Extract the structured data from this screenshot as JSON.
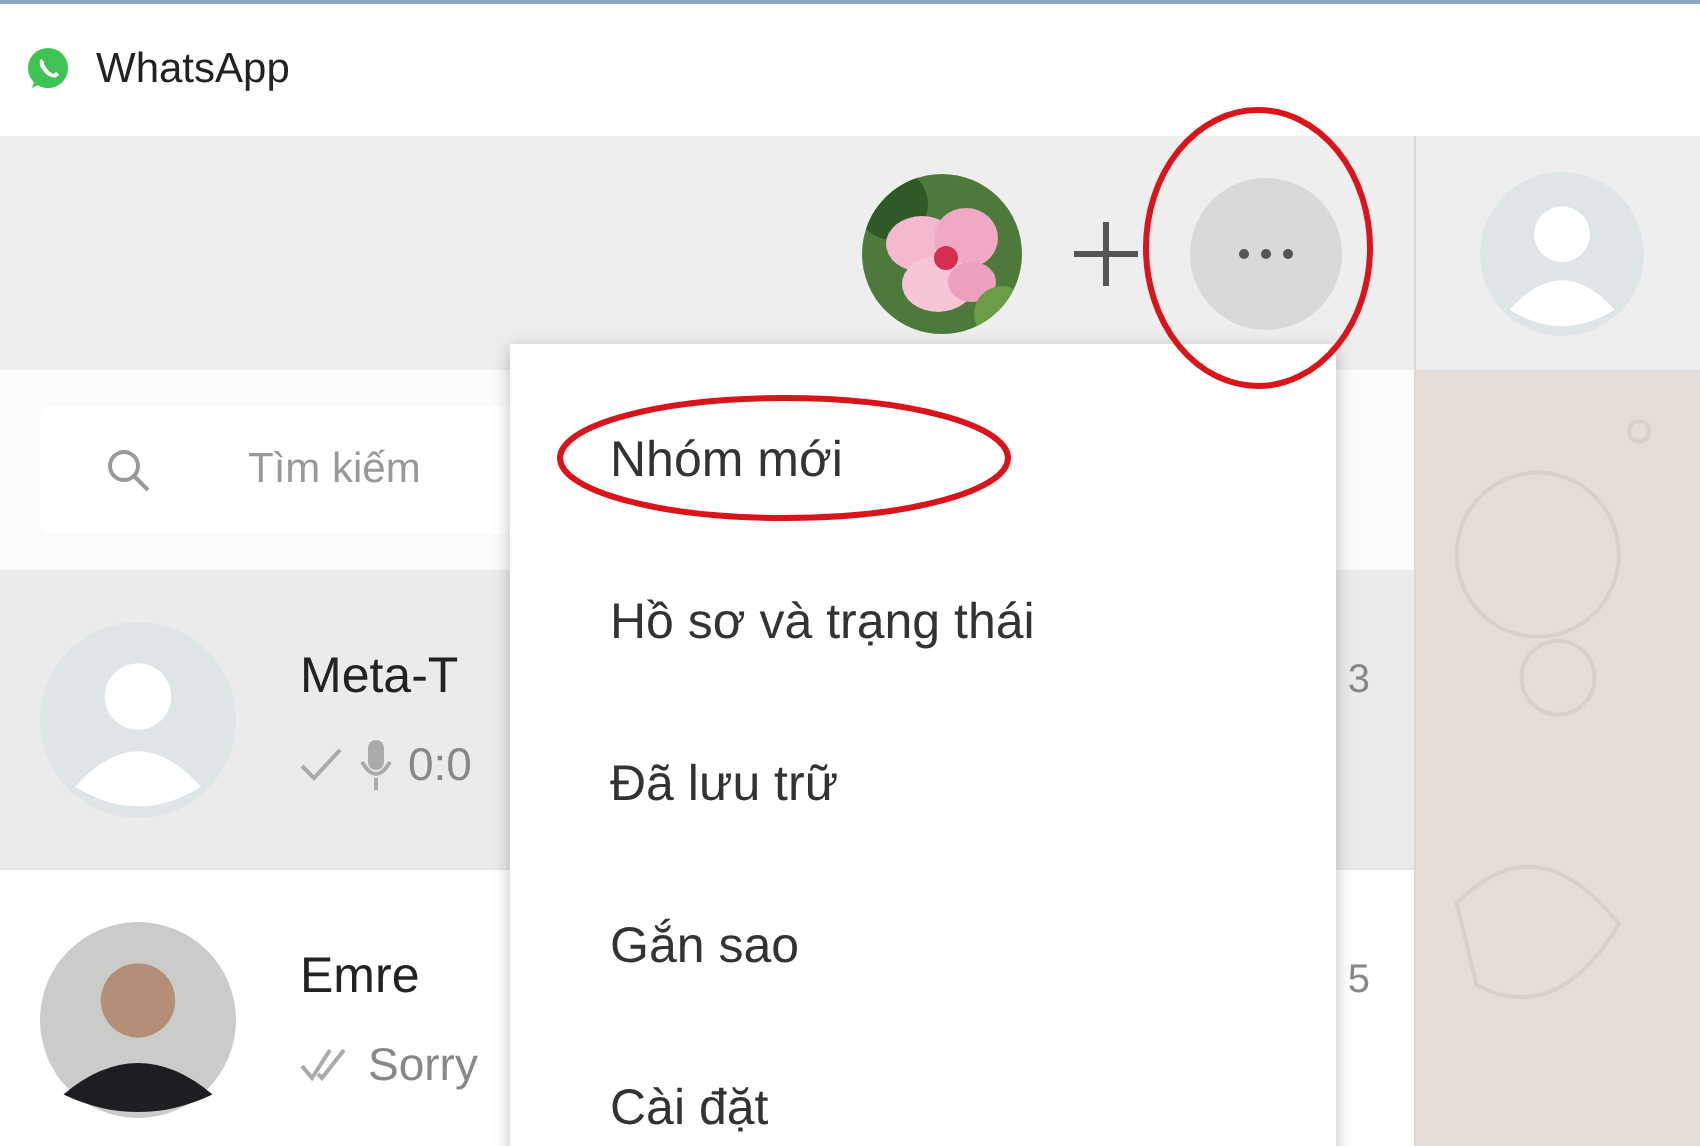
{
  "window": {
    "title": "WhatsApp"
  },
  "search": {
    "placeholder": "Tìm kiếm"
  },
  "chats": [
    {
      "name": "Meta-T",
      "preview": "0:0",
      "time": "3",
      "selected": true,
      "photo": false,
      "double_tick": false,
      "voice": true
    },
    {
      "name": "Emre",
      "preview": "Sorry",
      "time": "5",
      "selected": false,
      "photo": true,
      "double_tick": true,
      "voice": false
    }
  ],
  "menu": {
    "items": [
      {
        "label": "Nhóm mới",
        "highlighted": true
      },
      {
        "label": "Hồ sơ và trạng thái",
        "highlighted": false
      },
      {
        "label": "Đã lưu trữ",
        "highlighted": false
      },
      {
        "label": "Gắn sao",
        "highlighted": false
      },
      {
        "label": "Cài đặt",
        "highlighted": false
      }
    ]
  },
  "more_button": {
    "highlighted": true
  }
}
